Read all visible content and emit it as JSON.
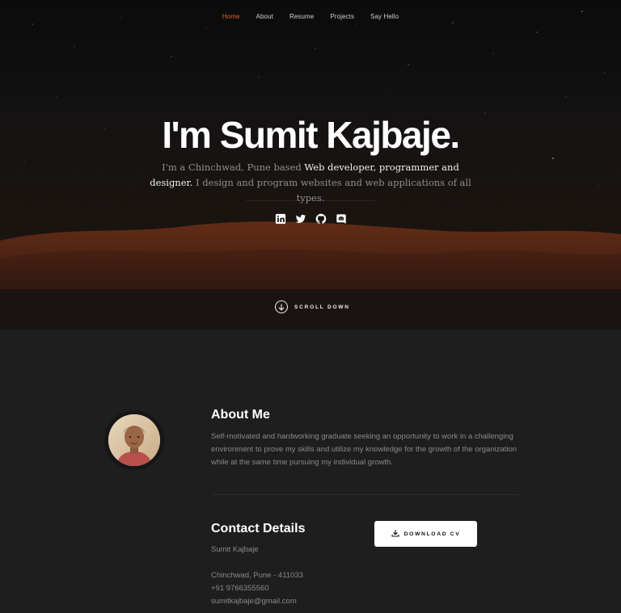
{
  "nav": {
    "items": [
      "Home",
      "About",
      "Resume",
      "Projects",
      "Say Hello"
    ],
    "active": "Home"
  },
  "hero": {
    "title": "I'm Sumit Kajbaje.",
    "subtitle_part1": "I'm a Chinchwad, Pune based ",
    "subtitle_highlight": "Web developer, programmer and designer.",
    "subtitle_part2": " I design and program websites and web applications of all types.",
    "socials": [
      "linkedin-icon",
      "twitter-icon",
      "github-icon",
      "discord-icon"
    ],
    "scroll_label": "SCROLL DOWN"
  },
  "about": {
    "title": "About Me",
    "text": "Self-motivated and hardworking graduate seeking an opportunity to work in a challenging environment to prove my skills and utilize my knowledge for the growth of the organization while at the same time pursuing my individual growth."
  },
  "contact": {
    "title": "Contact Details",
    "name": "Sumit Kajbaje",
    "address": "Chinchwad, Pune - 411033",
    "phone": "+91 9766355560",
    "email": "sumitkajbaje@gmail.com",
    "download_label": "DOWNLOAD CV"
  },
  "colors": {
    "accent": "#e0612a",
    "background": "#1e1e1e",
    "hero_dark": "#0d0d0d"
  }
}
